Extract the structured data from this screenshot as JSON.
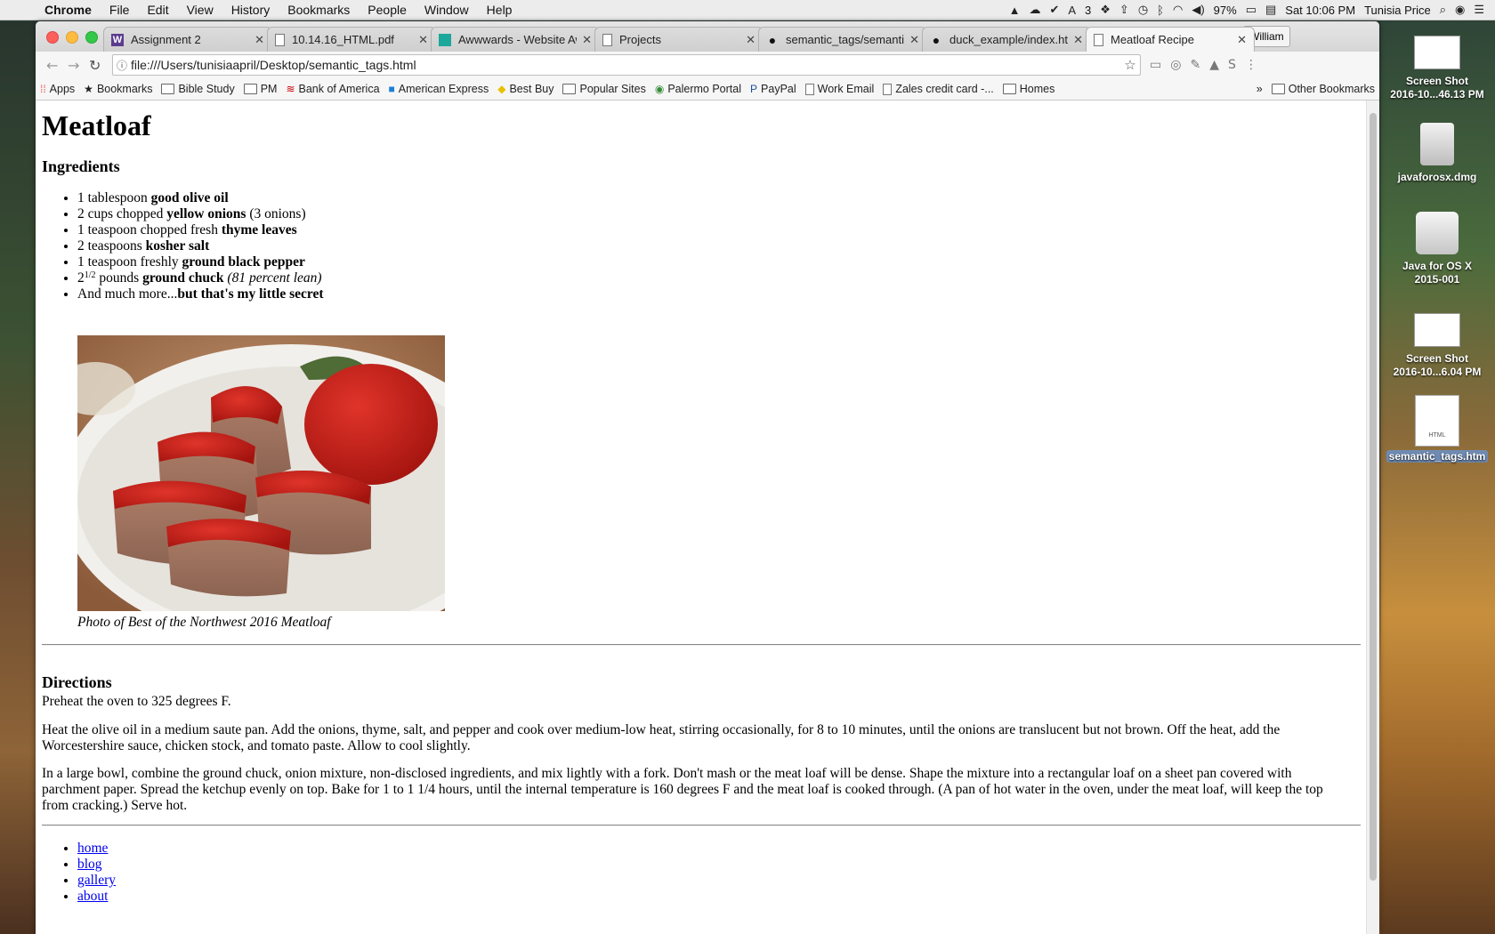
{
  "menubar": {
    "app": "Chrome",
    "items": [
      "File",
      "Edit",
      "View",
      "History",
      "Bookmarks",
      "People",
      "Window",
      "Help"
    ],
    "status_extra": "3",
    "battery": "97%",
    "clock": "Sat 10:06 PM",
    "user": "Tunisia Price"
  },
  "tabs": [
    {
      "title": "Assignment 2",
      "icon": "w-icon"
    },
    {
      "title": "10.14.16_HTML.pdf",
      "icon": "document-icon"
    },
    {
      "title": "Awwwards - Website Aw",
      "icon": "awwwards-icon"
    },
    {
      "title": "Projects",
      "icon": "document-icon"
    },
    {
      "title": "semantic_tags/semantic",
      "icon": "github-icon"
    },
    {
      "title": "duck_example/index.htm",
      "icon": "github-icon"
    },
    {
      "title": "Meatloaf Recipe",
      "icon": "document-icon",
      "active": true
    }
  ],
  "profile": "William",
  "address": "file:///Users/tunisiaapril/Desktop/semantic_tags.html",
  "bookmarks": {
    "items": [
      "Apps",
      "Bookmarks",
      "Bible Study",
      "PM",
      "Bank of America",
      "American Express",
      "Best Buy",
      "Popular Sites",
      "Palermo Portal",
      "PayPal",
      "Work Email",
      "Zales credit card -...",
      "Homes"
    ],
    "overflow": "»",
    "other": "Other Bookmarks"
  },
  "page": {
    "title": "Meatloaf",
    "ingredients_heading": "Ingredients",
    "ingredients": {
      "i1_pre": "1 tablespoon ",
      "i1_b": "good olive oil",
      "i2_pre": "2 cups chopped ",
      "i2_b": "yellow onions",
      "i2_post": " (3 onions)",
      "i3_pre": "1 teaspoon chopped fresh ",
      "i3_b": "thyme leaves",
      "i4_pre": "2 teaspoons ",
      "i4_b": "kosher salt",
      "i5_pre": "1 teaspoon freshly ",
      "i5_b": "ground black pepper",
      "i6_num": "2",
      "i6_sup": "1/2",
      "i6_pre": " pounds ",
      "i6_b": "ground chuck",
      "i6_i": "(81 percent lean)",
      "i7_pre": "And much more...",
      "i7_b": "but that's my little secret"
    },
    "caption": "Photo of Best of the Northwest 2016 Meatloaf",
    "directions_heading": "Directions",
    "directions": [
      "Preheat the oven to 325 degrees F.",
      "Heat the olive oil in a medium saute pan. Add the onions, thyme, salt, and pepper and cook over medium-low heat, stirring occasionally, for 8 to 10 minutes, until the onions are translucent but not brown. Off the heat, add the Worcestershire sauce, chicken stock, and tomato paste. Allow to cool slightly.",
      "In a large bowl, combine the ground chuck, onion mixture, non-disclosed ingredients, and mix lightly with a fork. Don't mash or the meat loaf will be dense. Shape the mixture into a rectangular loaf on a sheet pan covered with parchment paper. Spread the ketchup evenly on top. Bake for 1 to 1 1/4 hours, until the internal temperature is 160 degrees F and the meat loaf is cooked through. (A pan of hot water in the oven, under the meat loaf, will keep the top from cracking.) Serve hot."
    ],
    "nav": [
      "home",
      "blog",
      "gallery",
      "about"
    ]
  },
  "desktop": [
    {
      "label1": "Screen Shot",
      "label2": "2016-10...46.13 PM"
    },
    {
      "label1": "javaforosx.dmg",
      "label2": ""
    },
    {
      "label1": "Java for OS X",
      "label2": "2015-001"
    },
    {
      "label1": "Screen Shot",
      "label2": "2016-10...6.04 PM"
    },
    {
      "label1": "semantic_tags.htm",
      "label2": "",
      "badge": "HTML"
    }
  ],
  "colors": {
    "link": "#0000ee",
    "menubar": "#ececec",
    "ketchup": "#c41a14"
  }
}
